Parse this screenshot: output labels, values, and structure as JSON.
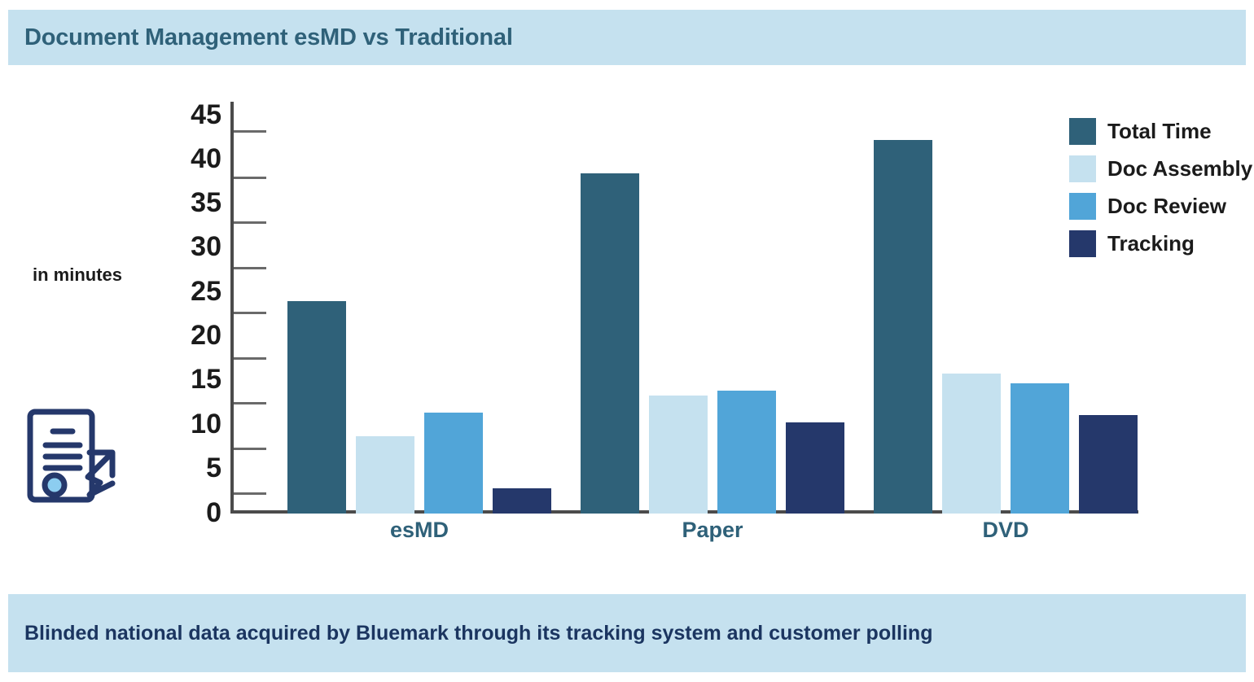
{
  "header": {
    "title": "Document Management esMD vs Traditional"
  },
  "footer": {
    "note": "Blinded national data acquired by Bluemark through its tracking system and customer polling"
  },
  "icons": {
    "document_upload": "document-upload-icon"
  },
  "chart_data": {
    "type": "bar",
    "title": "Document Management esMD vs Traditional",
    "xlabel": "",
    "ylabel": "in minutes",
    "ylim": [
      0,
      45
    ],
    "ytick_step": 5,
    "yticks": [
      "45",
      "40",
      "35",
      "30",
      "25",
      "20",
      "15",
      "10",
      "5",
      "0"
    ],
    "grid": false,
    "legend_position": "right",
    "categories": [
      "esMD",
      "Paper",
      "DVD"
    ],
    "series": [
      {
        "name": "Total Time",
        "color": "#2f6179",
        "values": [
          24,
          38.5,
          42.2
        ]
      },
      {
        "name": "Doc Assembly",
        "color": "#c5e1ef",
        "values": [
          8.7,
          13.3,
          15.8
        ]
      },
      {
        "name": "Doc Review",
        "color": "#51a5d8",
        "values": [
          11.4,
          13.9,
          14.7
        ]
      },
      {
        "name": "Tracking",
        "color": "#25386b",
        "values": [
          2.9,
          10.3,
          11.1
        ]
      }
    ]
  },
  "colors": {
    "band": "#c5e1ef",
    "title_text": "#2f6179",
    "footer_text": "#1b3560",
    "axis": "#4b4b4b",
    "category_text": "#2f6179"
  }
}
